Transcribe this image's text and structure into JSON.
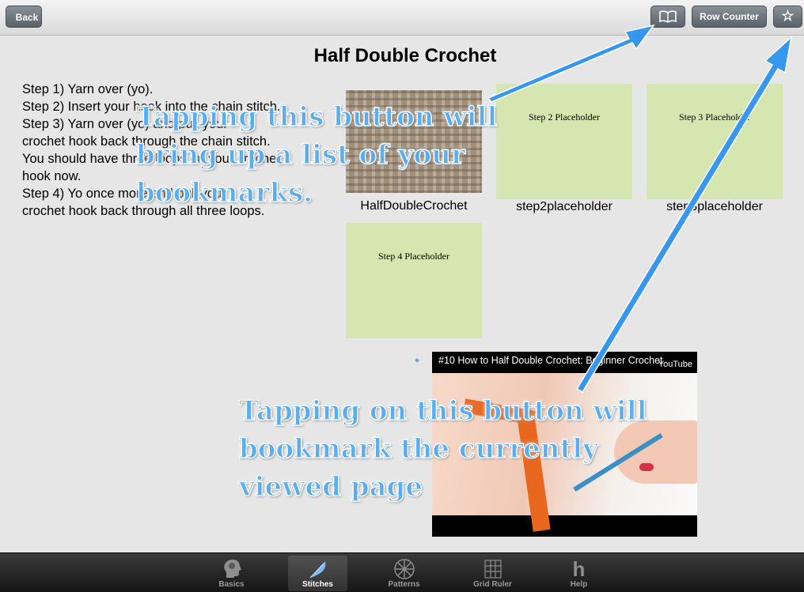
{
  "nav": {
    "back_label": "Back",
    "row_counter_label": "Row Counter",
    "bookmarks_icon": "book-icon",
    "star_icon": "star-icon",
    "star_glyph": "☆"
  },
  "page": {
    "title": "Half Double Crochet",
    "steps": [
      "Step 1) Yarn over (yo).",
      "Step 2) Insert your hook into the chain stitch.",
      "Step 3) Yarn over (yo) and pull your",
      "crochet hook back through the chain stitch.",
      "You should have three loops on your crochet",
      "hook now.",
      "Step 4) Yo once more and pull your",
      "crochet hook back through all three loops."
    ]
  },
  "gallery": [
    {
      "caption": "HalfDoubleCrochet",
      "placeholder_text": ""
    },
    {
      "caption": "step2placeholder",
      "placeholder_text": "Step 2 Placeholder"
    },
    {
      "caption": "step3placeholder",
      "placeholder_text": "Step 3 Placeholder"
    },
    {
      "caption": "",
      "placeholder_text": "Step 4 Placeholder"
    }
  ],
  "video": {
    "title": "#10 How to Half Double Crochet: Beginner Crochet",
    "provider": "YouTube"
  },
  "annotations": {
    "bookmarks_note": [
      "Tapping this button will",
      "bring up a list of your",
      "bookmarks."
    ],
    "bookmark_page_note": [
      "Tapping on this button will",
      "bookmark the currently",
      "viewed page"
    ],
    "arrow_color": "#2a8ef0"
  },
  "tabs": [
    {
      "label": "Basics",
      "icon": "head-icon",
      "active": false
    },
    {
      "label": "Stitches",
      "icon": "feather-icon",
      "active": true
    },
    {
      "label": "Patterns",
      "icon": "snowflake-icon",
      "active": false
    },
    {
      "label": "Grid Ruler",
      "icon": "grid-icon",
      "active": false
    },
    {
      "label": "Help",
      "icon": "help-icon",
      "active": false
    }
  ]
}
